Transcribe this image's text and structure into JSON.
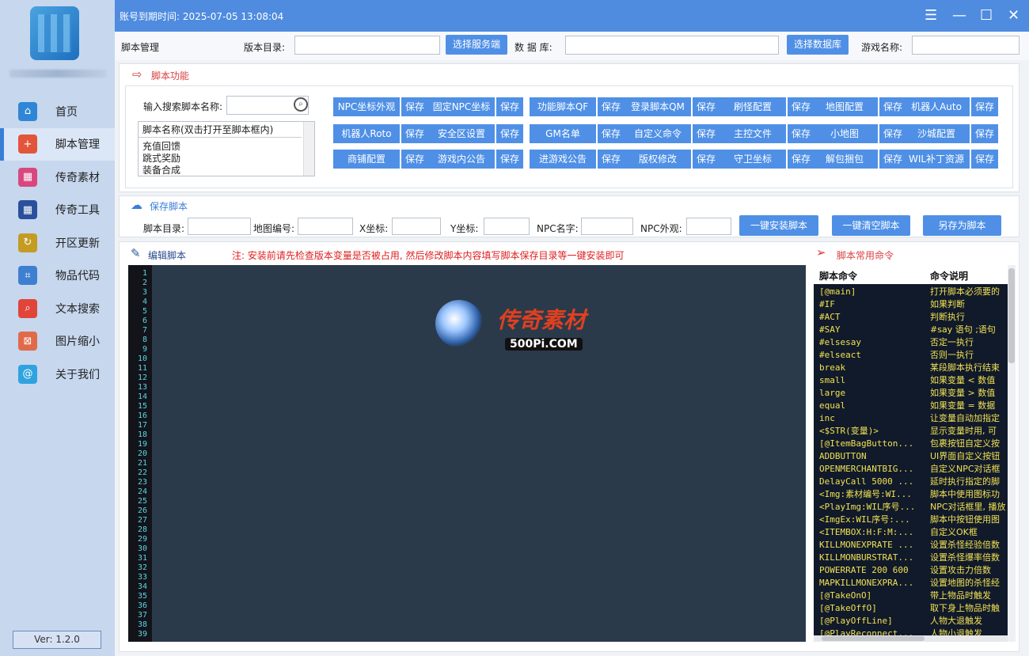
{
  "app": {
    "expire_text": "账号到期时间: 2025-07-05 13:08:04",
    "version": "Ver: 1.2.0"
  },
  "window_controls": {
    "menu": "☰",
    "minimize": "—",
    "maximize": "☐",
    "close": "✕"
  },
  "sidebar": {
    "items": [
      {
        "label": "首页",
        "icon": "home-icon",
        "color": "#2f86d6",
        "glyph": "⌂"
      },
      {
        "label": "脚本管理",
        "icon": "script-icon",
        "color": "#e2553b",
        "glyph": "+"
      },
      {
        "label": "传奇素材",
        "icon": "image-icon",
        "color": "#d9477f",
        "glyph": "▦"
      },
      {
        "label": "传奇工具",
        "icon": "tools-grid-icon",
        "color": "#2a4f9c",
        "glyph": "▦"
      },
      {
        "label": "开区更新",
        "icon": "refresh-icon",
        "color": "#c49c24",
        "glyph": "↻"
      },
      {
        "label": "物品代码",
        "icon": "code-icon",
        "color": "#3f7fd0",
        "glyph": "⌗"
      },
      {
        "label": "文本搜索",
        "icon": "search-icon",
        "color": "#e0453a",
        "glyph": "⌕"
      },
      {
        "label": "图片缩小",
        "icon": "shrink-icon",
        "color": "#e06a4a",
        "glyph": "⊠"
      },
      {
        "label": "关于我们",
        "icon": "about-icon",
        "color": "#2fa3e0",
        "glyph": "@"
      }
    ]
  },
  "toolbar": {
    "title": "脚本管理",
    "version_dir_label": "版本目录:",
    "select_server_btn": "选择服务端",
    "db_label": "数 据 库:",
    "select_db_btn": "选择数据库",
    "game_name_label": "游戏名称:"
  },
  "script_func": {
    "title": "脚本功能",
    "search_label": "输入搜索脚本名称:",
    "list_header": "脚本名称(双击打开至脚本框内)",
    "list_items": [
      "充值回馈",
      "跳式奖励",
      "装备合成"
    ],
    "buttons": [
      [
        "NPC坐标外观",
        "固定NPC坐标",
        "功能脚本QF",
        "登录脚本QM",
        "刷怪配置",
        "地图配置",
        "机器人Auto"
      ],
      [
        "机器人Roto",
        "安全区设置",
        "GM名单",
        "自定义命令",
        "主控文件",
        "小地图",
        "沙城配置"
      ],
      [
        "商铺配置",
        "游戏内公告",
        "进游戏公告",
        "版权修改",
        "守卫坐标",
        "解包捆包",
        "WIL补丁资源"
      ]
    ],
    "save_label": "保存"
  },
  "save_script": {
    "title": "保存脚本",
    "dir_label": "脚本目录:",
    "map_label": "地图编号:",
    "x_label": "X坐标:",
    "y_label": "Y坐标:",
    "npc_name_label": "NPC名字:",
    "npc_look_label": "NPC外观:",
    "install_btn": "一键安装脚本",
    "clear_btn": "一键清空脚本",
    "save_as_btn": "另存为脚本"
  },
  "editor": {
    "title": "编辑脚本",
    "notice": "注: 安装前请先检查版本变量是否被占用, 然后修改脚本内容填写脚本保存目录等一键安装即可",
    "watermark_cn": "传奇素材",
    "watermark_en": "500Pi.COM",
    "line_count": 39
  },
  "commands": {
    "title": "脚本常用命令",
    "col_cmd": "脚本命令",
    "col_desc": "命令说明",
    "rows": [
      [
        "[@main]",
        "打开脚本必须要的"
      ],
      [
        "#IF",
        "如果判断"
      ],
      [
        "#ACT",
        "判断执行"
      ],
      [
        "#SAY",
        "#say 语句 ;语句"
      ],
      [
        "#elsesay",
        "否定一执行"
      ],
      [
        "#elseact",
        "否则一执行"
      ],
      [
        "break",
        "某段脚本执行结束"
      ],
      [
        "small",
        "如果变量 < 数值"
      ],
      [
        "large",
        "如果变量 > 数值"
      ],
      [
        "equal",
        "如果变量 = 数据"
      ],
      [
        "inc",
        "让变量自动加指定"
      ],
      [
        "<$STR(变量)>",
        "显示变量时用, 可"
      ],
      [
        "[@ItemBagButton...",
        "包裹按钮自定义按"
      ],
      [
        "ADDBUTTON",
        "UI界面自定义按钮"
      ],
      [
        "OPENMERCHANTBIG...",
        "自定义NPC对话框"
      ],
      [
        "DelayCall 5000 ...",
        "延时执行指定的脚"
      ],
      [
        "<Img:素材编号:WI...",
        "脚本中使用图标功"
      ],
      [
        "<PlayImg:WIL序号...",
        "NPC对话框里, 播放"
      ],
      [
        "<ImgEx:WIL序号:...",
        "脚本中按钮使用图"
      ],
      [
        "<ITEMBOX:H:F:M:...",
        "自定义OK框"
      ],
      [
        "KILLMONEXPRATE ...",
        "设置杀怪经验倍数"
      ],
      [
        "KILLMONBURSTRAT...",
        "设置杀怪爆率倍数"
      ],
      [
        "POWERRATE 200 600",
        "设置攻击力倍数"
      ],
      [
        "MAPKILLMONEXPRA...",
        "设置地图的杀怪经"
      ],
      [
        "[@TakeOnO]",
        "带上物品时触发"
      ],
      [
        "[@TakeOffO]",
        "取下身上物品时触"
      ],
      [
        "[@PlayOffLine]",
        "人物大退触发"
      ],
      [
        "[@PlayReconnect...",
        "人物小退触发"
      ]
    ]
  }
}
